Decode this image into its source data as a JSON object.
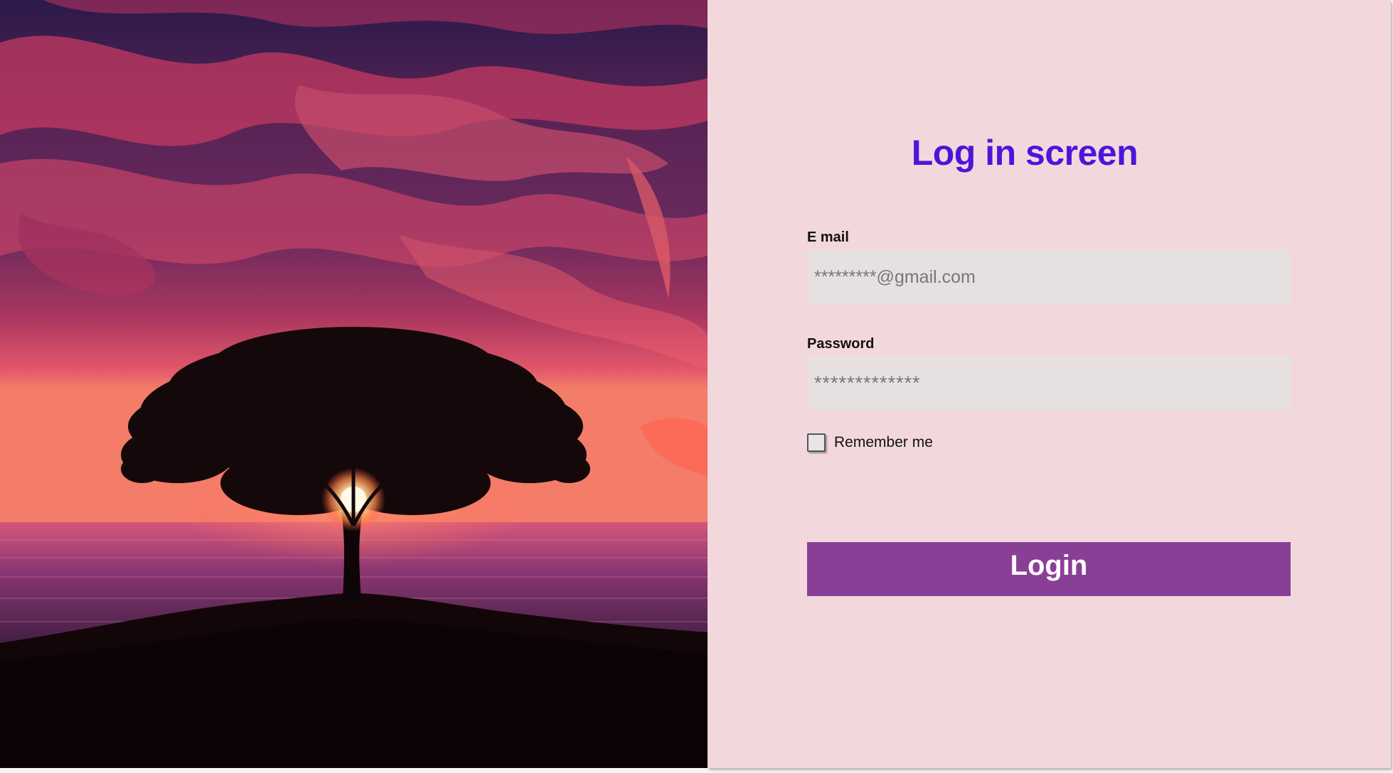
{
  "hero": {
    "image": "sunset-tree-over-sea"
  },
  "login": {
    "title": "Log in screen",
    "email_label": "E mail",
    "email_placeholder": "*********@gmail.com",
    "password_label": "Password",
    "password_placeholder": "*************",
    "remember_label": "Remember me",
    "remember_checked": false,
    "button_label": "Login"
  },
  "colors": {
    "panel_bg": "#f2d8dd",
    "title": "#4b16db",
    "input_bg": "#e6e0e1",
    "button_bg": "#8a3f96",
    "button_text": "#ffffff"
  }
}
